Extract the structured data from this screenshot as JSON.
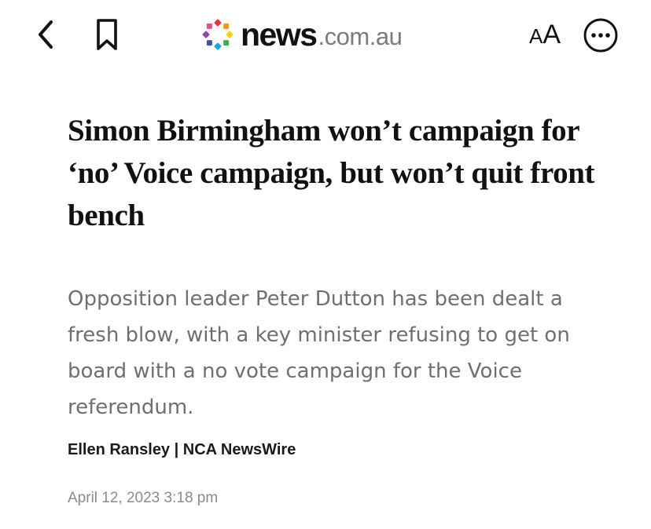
{
  "toolbar": {
    "back_icon": "chevron-left-icon",
    "bookmark_icon": "bookmark-icon",
    "font_size_small": "A",
    "font_size_large": "A",
    "more_icon": "more-horizontal-circle-icon"
  },
  "logo": {
    "brand": "news",
    "domain": ".com.au",
    "colors": [
      "#e7343f",
      "#f7941d",
      "#fdd100",
      "#37b34a",
      "#1ba6e0",
      "#3f51b5",
      "#8e44ad",
      "#e74c8b"
    ]
  },
  "article": {
    "headline": "Simon Birmingham won’t campaign for ‘no’ Voice campaign, but won’t quit front bench",
    "standfirst": "Opposition leader Peter Dutton has been dealt a fresh blow, with a key minister refusing to get on board with a no vote campaign for the Voice referendum.",
    "byline": "Ellen Ransley | NCA NewsWire",
    "date": "April 12, 2023 3:18 pm"
  }
}
